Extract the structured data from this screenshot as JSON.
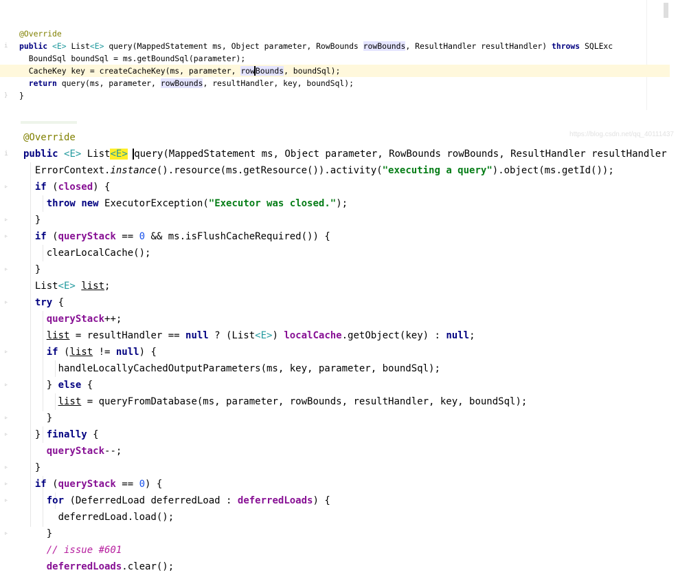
{
  "snippet1": {
    "lines": [
      "@Override",
      "public <E> List<E> query(MappedStatement ms, Object parameter, RowBounds rowBounds, ResultHandler resultHandler) throws SQLExc",
      "  BoundSql boundSql = ms.getBoundSql(parameter);",
      "  CacheKey key = createCacheKey(ms, parameter, rowBounds, boundSql);",
      "  return query(ms, parameter, rowBounds, resultHandler, key, boundSql);",
      "}"
    ],
    "watermark": "https://blog.csdn.net/qq_40111437"
  },
  "snippet2": {
    "lines": [
      "@Override",
      "public <E> List<E> query(MappedStatement ms, Object parameter, RowBounds rowBounds, ResultHandler resultHandler",
      "  ErrorContext.instance().resource(ms.getResource()).activity(\"executing a query\").object(ms.getId());",
      "  if (closed) {",
      "    throw new ExecutorException(\"Executor was closed.\");",
      "  }",
      "  if (queryStack == 0 && ms.isFlushCacheRequired()) {",
      "    clearLocalCache();",
      "  }",
      "  List<E> list;",
      "  try {",
      "    queryStack++;",
      "    list = resultHandler == null ? (List<E>) localCache.getObject(key) : null;",
      "    if (list != null) {",
      "      handleLocallyCachedOutputParameters(ms, key, parameter, boundSql);",
      "    } else {",
      "      list = queryFromDatabase(ms, parameter, rowBounds, resultHandler, key, boundSql);",
      "    }",
      "  } finally {",
      "    queryStack--;",
      "  }",
      "  if (queryStack == 0) {",
      "    for (DeferredLoad deferredLoad : deferredLoads) {",
      "      deferredLoad.load();",
      "    }",
      "    // issue #601",
      "    deferredLoads.clear();"
    ]
  }
}
